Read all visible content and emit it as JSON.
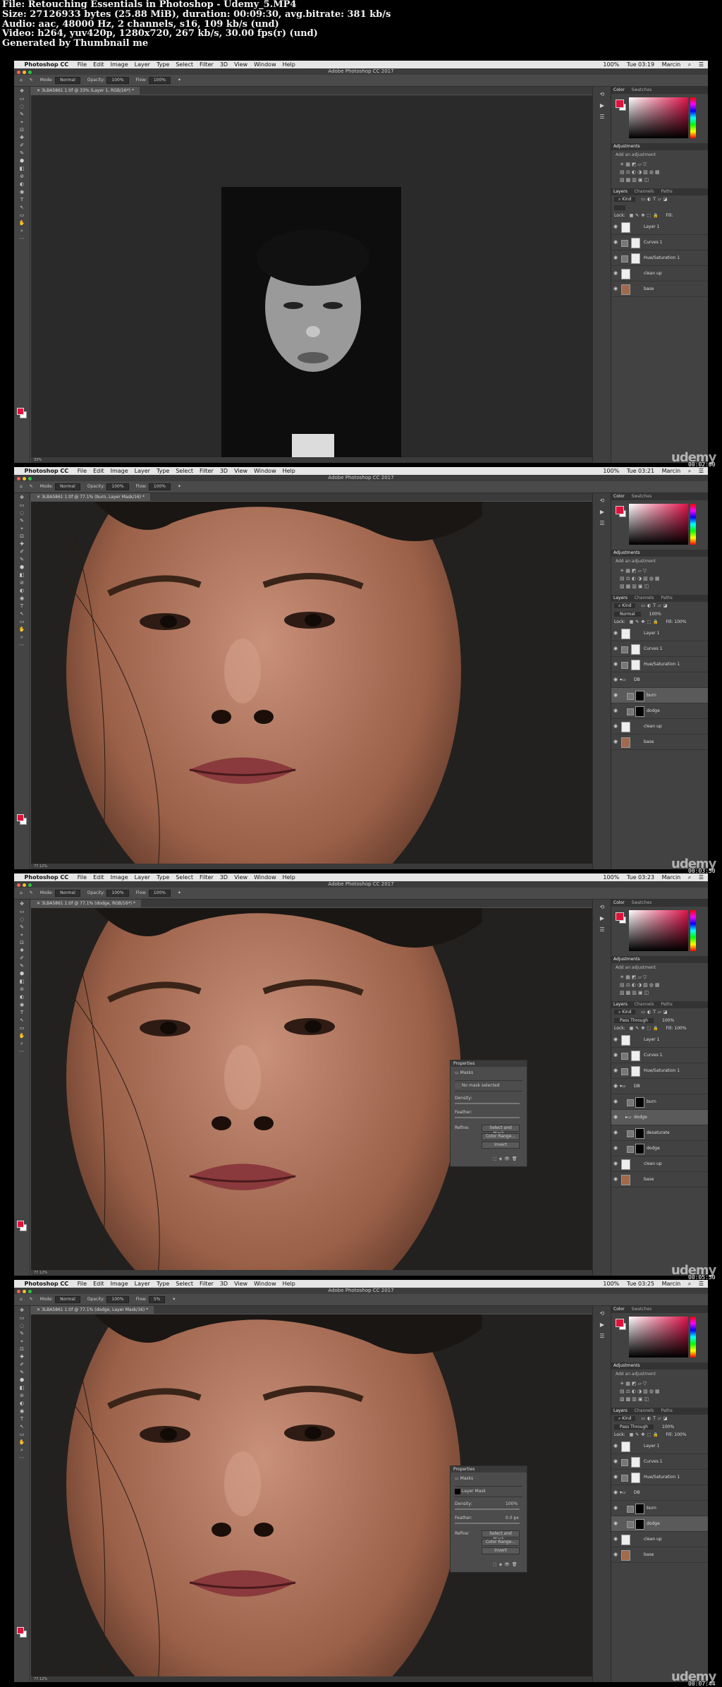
{
  "video_info": {
    "lines": [
      "File: Retouching Essentials in Photoshop - Udemy_5.MP4",
      "Size: 27126933 bytes (25.88 MiB), duration: 00:09:30, avg.bitrate: 381 kb/s",
      "Audio: aac, 48000 Hz, 2 channels, s16, 109 kb/s (und)",
      "Video: h264, yuv420p, 1280x720, 267 kb/s, 30.00 fps(r) (und)",
      "Generated by Thumbnail me"
    ]
  },
  "watermark": "udemy",
  "icons": {
    "close": "close-icon",
    "eye": "eye-icon",
    "mask": "mask-icon",
    "folder": "folder-icon",
    "brush": "brush-icon"
  },
  "colors": {
    "foreground": "#e0123c",
    "background": "#ffffff",
    "canvas_bg": "#535353"
  },
  "menubar": {
    "app": "Photoshop CC",
    "items": [
      "File",
      "Edit",
      "Image",
      "Layer",
      "Type",
      "Select",
      "Filter",
      "3D",
      "View",
      "Window",
      "Help"
    ],
    "battery": "100%",
    "user": "Marcin"
  },
  "window_title": "Adobe Photoshop CC 2017",
  "panels": {
    "color_tabs": [
      "Color",
      "Swatches"
    ],
    "adjustments_title": "Adjustments",
    "adjustments_subtitle": "Add an adjustment",
    "layers_tabs": [
      "Layers",
      "Channels",
      "Paths"
    ],
    "kind": "Kind",
    "lock": "Lock:",
    "fill": "Fill:"
  },
  "frames": [
    {
      "clock": "Tue 03:19",
      "doc_tab": "3LBA5861 1.tif @ 33% (Layer 1, RGB/16*) *",
      "mode": "Normal",
      "opacity": "100%",
      "flow": "100%",
      "status": "33%",
      "blend": "",
      "layer_opacity": "",
      "layer_fill": "",
      "timestamp": "00:02:00",
      "layers": [
        {
          "name": "Layer 1",
          "type": "white"
        },
        {
          "name": "Curves 1",
          "type": "adj"
        },
        {
          "name": "Hue/Saturation 1",
          "type": "adj"
        },
        {
          "name": "clean up",
          "type": "white"
        },
        {
          "name": "base",
          "type": "face"
        }
      ]
    },
    {
      "clock": "Tue 03:21",
      "doc_tab": "3LBA5861 1.tif @ 77.1% (burn, Layer Mask/16) *",
      "mode": "Normal",
      "opacity": "100%",
      "flow": "100%",
      "status": "77.12%",
      "blend": "Normal",
      "layer_opacity": "100%",
      "layer_fill": "100%",
      "timestamp": "00:03:50",
      "layers": [
        {
          "name": "Layer 1",
          "type": "white"
        },
        {
          "name": "Curves 1",
          "type": "adj"
        },
        {
          "name": "Hue/Saturation 1",
          "type": "adj"
        },
        {
          "name": "DB",
          "type": "group"
        },
        {
          "name": "burn",
          "type": "mask",
          "selected": true
        },
        {
          "name": "dodge",
          "type": "mask"
        },
        {
          "name": "clean up",
          "type": "white"
        },
        {
          "name": "base",
          "type": "face"
        }
      ]
    },
    {
      "clock": "Tue 03:23",
      "doc_tab": "3LBA5861 1.tif @ 77.1% (dodge, RGB/16*) *",
      "mode": "Normal",
      "opacity": "100%",
      "flow": "100%",
      "status": "77.12%",
      "blend": "Pass Through",
      "layer_opacity": "100%",
      "layer_fill": "100%",
      "timestamp": "00:05:50",
      "layers": [
        {
          "name": "Layer 1",
          "type": "white"
        },
        {
          "name": "Curves 1",
          "type": "adj"
        },
        {
          "name": "Hue/Saturation 1",
          "type": "adj"
        },
        {
          "name": "DB",
          "type": "group"
        },
        {
          "name": "burn",
          "type": "mask"
        },
        {
          "name": "dodge",
          "type": "folder",
          "selected": true
        },
        {
          "name": "desaturate",
          "type": "mask"
        },
        {
          "name": "dodge",
          "type": "mask"
        },
        {
          "name": "clean up",
          "type": "white"
        },
        {
          "name": "base",
          "type": "face"
        }
      ],
      "properties": {
        "title": "Properties",
        "section": "Masks",
        "mask_label": "No mask selected",
        "density": "Density:",
        "feather": "Feather:",
        "refine": "Refine:",
        "buttons": [
          "Select and Mask...",
          "Color Range...",
          "Invert"
        ]
      }
    },
    {
      "clock": "Tue 03:25",
      "doc_tab": "3LBA5861 1.tif @ 77.1% (dodge, Layer Mask/16) *",
      "mode": "Normal",
      "opacity": "100%",
      "flow": "5%",
      "status": "77.12%",
      "blend": "Pass Through",
      "layer_opacity": "100%",
      "layer_fill": "100%",
      "timestamp": "00:07:44",
      "layers": [
        {
          "name": "Layer 1",
          "type": "white"
        },
        {
          "name": "Curves 1",
          "type": "adj"
        },
        {
          "name": "Hue/Saturation 1",
          "type": "adj"
        },
        {
          "name": "DB",
          "type": "group"
        },
        {
          "name": "burn",
          "type": "mask"
        },
        {
          "name": "dodge",
          "type": "mask",
          "selected": true
        },
        {
          "name": "clean up",
          "type": "white"
        },
        {
          "name": "base",
          "type": "face"
        }
      ],
      "properties": {
        "title": "Properties",
        "section": "Masks",
        "mask_label": "Layer Mask",
        "density": "Density:",
        "density_value": "100%",
        "feather": "Feather:",
        "feather_value": "0.0 px",
        "refine": "Refine:",
        "buttons": [
          "Select and Mask...",
          "Color Range...",
          "Invert"
        ]
      }
    }
  ]
}
